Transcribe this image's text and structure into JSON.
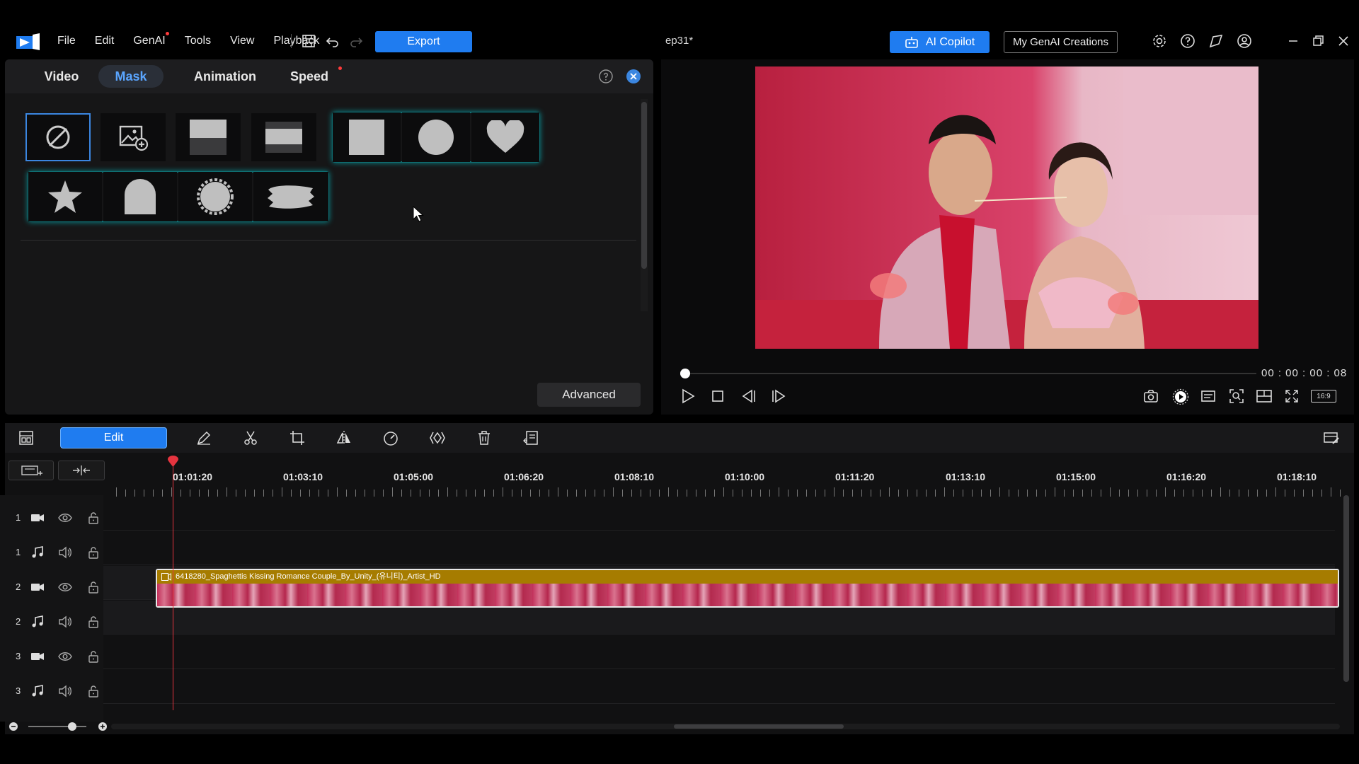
{
  "app": {
    "menu": [
      "File",
      "Edit",
      "GenAI",
      "Tools",
      "View",
      "Playback"
    ],
    "export_label": "Export",
    "project_name": "ep31*",
    "ai_copilot_label": "AI Copilot",
    "my_genai_label": "My GenAI Creations"
  },
  "panel": {
    "tabs": [
      "Video",
      "Mask",
      "Animation",
      "Speed"
    ],
    "active_tab": "Mask",
    "advanced_label": "Advanced",
    "masks": [
      "none",
      "image-mask",
      "linear-top",
      "linear-middle",
      "rectangle",
      "circle",
      "heart",
      "star",
      "arch",
      "sunburst",
      "brush"
    ]
  },
  "preview": {
    "timecode": "00 : 00 : 00 : 08",
    "aspect_label": "16:9"
  },
  "timeline": {
    "edit_label": "Edit",
    "ruler": [
      "01:01:20",
      "01:03:10",
      "01:05:00",
      "01:06:20",
      "01:08:10",
      "01:10:00",
      "01:11:20",
      "01:13:10",
      "01:15:00",
      "01:16:20",
      "01:18:10"
    ],
    "tracks": [
      "1",
      "1",
      "2",
      "2",
      "3",
      "3"
    ],
    "clip_title": "6418280_Spaghettis Kissing Romance Couple_By_Unity_(유니티)_Artist_HD"
  },
  "colors": {
    "accent": "#1f7cf0",
    "mask_glow": "#0b8a8e",
    "clip_header": "#a67c00",
    "playhead": "#e5343f"
  }
}
